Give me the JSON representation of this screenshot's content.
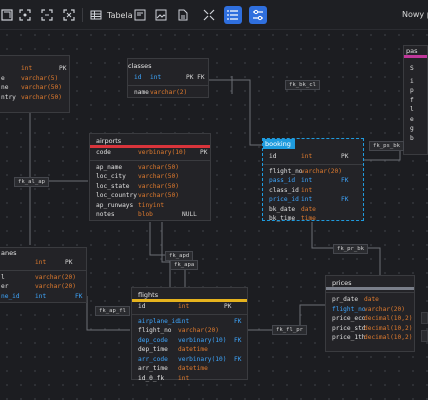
{
  "toolbar": {
    "table_label": "Tabela",
    "new_project": "Nowy pr",
    "icons": [
      "expand-all-icon",
      "collapse-icon",
      "fit-icon",
      "table-icon",
      "note-icon",
      "image-icon",
      "export-icon",
      "fullscreen-icon",
      "list-icon",
      "settings-icon"
    ]
  },
  "colors": {
    "accent": "#2f6fde",
    "type": "#e07b2e",
    "fk": "#3ea7ff",
    "airports": "#d9343b",
    "flights": "#e6b31e",
    "booking": "#1e9bde",
    "prices": "#7a7f8a",
    "passenger": "#c0379a"
  },
  "tables": {
    "left_top": {
      "rows": [
        {
          "c1": "",
          "c2": "int",
          "c3": "PK"
        },
        {
          "c1": "e",
          "c2": "varchar(5)",
          "c3": ""
        },
        {
          "c1": "ne",
          "c2": "varchar(50)",
          "c3": ""
        },
        {
          "c1": "ntry",
          "c2": "varchar(50)",
          "c3": ""
        }
      ]
    },
    "classes": {
      "name": "classes",
      "rows": [
        {
          "c1": "id",
          "c2": "int",
          "c3": "PK FK"
        },
        {
          "c1": "name",
          "c2": "varchar(2)",
          "c3": ""
        }
      ]
    },
    "airports": {
      "name": "airports",
      "rows": [
        {
          "c1": "code",
          "c2": "verbinary(10)",
          "c3": "PK"
        },
        {
          "c1": "ap_name",
          "c2": "varchar(50)",
          "c3": ""
        },
        {
          "c1": "loc_city",
          "c2": "varchar(50)",
          "c3": ""
        },
        {
          "c1": "loc_state",
          "c2": "varchar(50)",
          "c3": ""
        },
        {
          "c1": "loc_country",
          "c2": "varchar(50)",
          "c3": ""
        },
        {
          "c1": "ap_runways",
          "c2": "tinyint",
          "c3": ""
        },
        {
          "c1": "notes",
          "c2": "blob",
          "c3": "NULL"
        }
      ]
    },
    "booking": {
      "name": "booking",
      "rows": [
        {
          "c1": "id",
          "c2": "int",
          "c3": "PK",
          "fk": false
        },
        {
          "c1": "flight_no",
          "c2": "varchar(20)",
          "c3": "",
          "fk": false
        },
        {
          "c1": "pass_id",
          "c2": "int",
          "c3": "FK",
          "fk": true
        },
        {
          "c1": "class_id",
          "c2": "int",
          "c3": "",
          "fk": false
        },
        {
          "c1": "price_id",
          "c2": "int",
          "c3": "FK",
          "fk": true
        },
        {
          "c1": "bk_date",
          "c2": "date",
          "c3": "",
          "fk": false
        },
        {
          "c1": "bk_time",
          "c2": "time",
          "c3": "",
          "fk": false
        }
      ]
    },
    "planes": {
      "name": "anes",
      "rows": [
        {
          "c1": "",
          "c2": "int",
          "c3": "PK",
          "fk": false
        },
        {
          "c1": "l",
          "c2": "varchar(20)",
          "c3": "",
          "fk": false
        },
        {
          "c1": "er",
          "c2": "varchar(20)",
          "c3": "",
          "fk": false
        },
        {
          "c1": "ne_id",
          "c2": "int",
          "c3": "FK",
          "fk": true
        }
      ]
    },
    "flights": {
      "name": "flights",
      "rows": [
        {
          "c1": "id",
          "c2": "int",
          "c3": "PK",
          "fk": false
        },
        {
          "c1": "airplane_id",
          "c2": "int",
          "c3": "FK",
          "fk": true
        },
        {
          "c1": "flight_no",
          "c2": "varchar(20)",
          "c3": "",
          "fk": false
        },
        {
          "c1": "dep_code",
          "c2": "verbinary(10)",
          "c3": "FK",
          "fk": true
        },
        {
          "c1": "dep_time",
          "c2": "datetime",
          "c3": "",
          "fk": false
        },
        {
          "c1": "arr_code",
          "c2": "verbinary(10)",
          "c3": "FK",
          "fk": true
        },
        {
          "c1": "arr_time",
          "c2": "datetime",
          "c3": "",
          "fk": false
        },
        {
          "c1": "id_0_fk",
          "c2": "int",
          "c3": "",
          "fk": false
        }
      ]
    },
    "prices": {
      "name": "prices",
      "rows": [
        {
          "c1": "pr_date",
          "c2": "date",
          "c3": "",
          "fk": false
        },
        {
          "c1": "flight_no",
          "c2": "varchar(20)",
          "c3": "",
          "fk": true
        },
        {
          "c1": "price_eco",
          "c2": "decimal(10,2)",
          "c3": "",
          "fk": false
        },
        {
          "c1": "price_std",
          "c2": "decimal(10,2)",
          "c3": "",
          "fk": false
        },
        {
          "c1": "price_1th",
          "c2": "decimal(10,2)",
          "c3": "",
          "fk": false
        }
      ]
    },
    "passenger": {
      "name": "pas",
      "rows": [
        "S",
        "i",
        "p",
        "f",
        "l",
        "e",
        "g",
        "b"
      ]
    }
  },
  "relations": [
    "fk_bk_cl",
    "fk_ps_bk",
    "fk_al_ap",
    "fk_apd",
    "fk_apa",
    "fk_pr_bk",
    "fk_ap_fl",
    "fk_fl_pr"
  ]
}
